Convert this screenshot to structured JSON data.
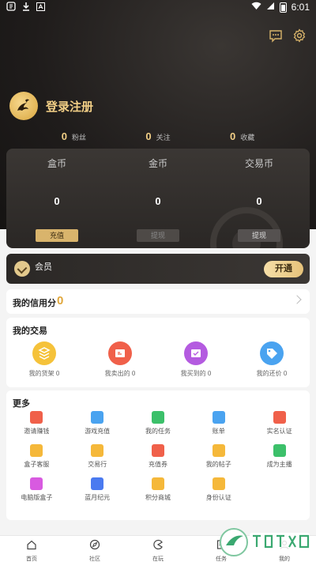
{
  "status_bar": {
    "time": "6:01"
  },
  "header": {
    "login_text": "登录注册"
  },
  "stats": [
    {
      "value": "0",
      "label": "粉丝"
    },
    {
      "value": "0",
      "label": "关注"
    },
    {
      "value": "0",
      "label": "收藏"
    }
  ],
  "wallet": {
    "columns": [
      {
        "label": "盒币",
        "value": "0",
        "button": "充值"
      },
      {
        "label": "金币",
        "value": "0",
        "button": "提现"
      },
      {
        "label": "交易币",
        "value": "0",
        "button": "提现"
      }
    ]
  },
  "member": {
    "label": "会员",
    "button": "开通"
  },
  "credit": {
    "title": "我的信用分",
    "value": "0"
  },
  "trade": {
    "title": "我的交易",
    "items": [
      {
        "label": "我的货架 0",
        "color": "#f5c23a"
      },
      {
        "label": "我卖出的 0",
        "color": "#f0604a"
      },
      {
        "label": "我买到的 0",
        "color": "#b45be0"
      },
      {
        "label": "我的还价 0",
        "color": "#4aa3f0"
      }
    ]
  },
  "more": {
    "title": "更多",
    "items": [
      {
        "label": "邀请赚钱",
        "color": "#f0604a"
      },
      {
        "label": "游戏充值",
        "color": "#4aa3f0"
      },
      {
        "label": "我的任务",
        "color": "#3cc06a"
      },
      {
        "label": "账单",
        "color": "#4aa3f0"
      },
      {
        "label": "实名认证",
        "color": "#f0604a"
      },
      {
        "label": "盒子客服",
        "color": "#f5b83a"
      },
      {
        "label": "交易行",
        "color": "#f5b83a"
      },
      {
        "label": "充值券",
        "color": "#f0604a"
      },
      {
        "label": "我的帖子",
        "color": "#f5b83a"
      },
      {
        "label": "成为主播",
        "color": "#3cc06a"
      },
      {
        "label": "电脑版盒子",
        "color": "#d85ae0"
      },
      {
        "label": "蓝月纪元",
        "color": "#4a7af0"
      },
      {
        "label": "积分商城",
        "color": "#f5b83a"
      },
      {
        "label": "身份认证",
        "color": "#f5b83a"
      }
    ]
  },
  "nav": [
    {
      "label": "首页",
      "icon": "home-icon"
    },
    {
      "label": "社区",
      "icon": "compass-icon"
    },
    {
      "label": "在玩",
      "icon": "pacman-icon"
    },
    {
      "label": "任务",
      "icon": "task-icon"
    },
    {
      "label": "我的",
      "icon": "user-icon"
    }
  ],
  "colors": {
    "gold": "#f2cf86",
    "dark": "#1f1c1b"
  }
}
